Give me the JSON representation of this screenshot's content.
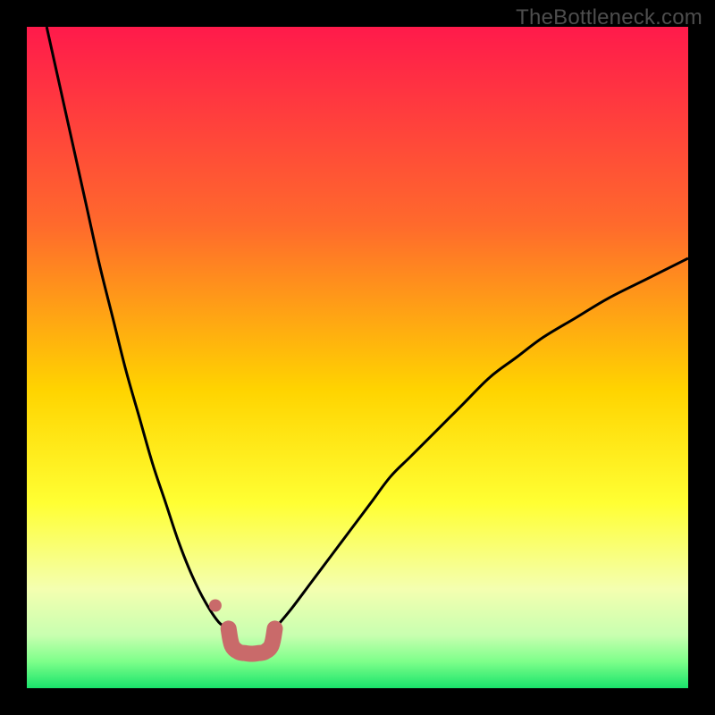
{
  "watermark": "TheBottleneck.com",
  "chart_data": {
    "type": "line",
    "title": "",
    "xlabel": "",
    "ylabel": "",
    "xlim": [
      0,
      100
    ],
    "ylim": [
      0,
      100
    ],
    "series": [
      {
        "name": "left-curve",
        "x": [
          3,
          5,
          7,
          9,
          11,
          13,
          15,
          17,
          19,
          21,
          23,
          25,
          27,
          29,
          30.5
        ],
        "values": [
          100,
          91,
          82,
          73,
          64,
          56,
          48,
          41,
          34,
          28,
          22,
          17,
          13,
          10,
          9
        ]
      },
      {
        "name": "right-curve",
        "x": [
          37.5,
          40,
          43,
          46,
          49,
          52,
          55,
          58,
          62,
          66,
          70,
          74,
          78,
          83,
          88,
          94,
          100
        ],
        "values": [
          9,
          12,
          16,
          20,
          24,
          28,
          32,
          35,
          39,
          43,
          47,
          50,
          53,
          56,
          59,
          62,
          65
        ]
      },
      {
        "name": "highlight-u",
        "x": [
          30.5,
          31,
          32,
          33,
          34,
          35,
          36,
          37,
          37.5
        ],
        "values": [
          9,
          6.5,
          5.5,
          5.3,
          5.2,
          5.3,
          5.5,
          6.5,
          9
        ]
      },
      {
        "name": "highlight-dot",
        "x": [
          28.5
        ],
        "values": [
          12.5
        ]
      }
    ],
    "background_gradient": {
      "stops": [
        {
          "offset": 0.0,
          "color": "#ff1a4b"
        },
        {
          "offset": 0.3,
          "color": "#ff6a2c"
        },
        {
          "offset": 0.55,
          "color": "#ffd400"
        },
        {
          "offset": 0.72,
          "color": "#ffff33"
        },
        {
          "offset": 0.85,
          "color": "#f4ffb0"
        },
        {
          "offset": 0.92,
          "color": "#c8ffb0"
        },
        {
          "offset": 0.96,
          "color": "#7dff8a"
        },
        {
          "offset": 1.0,
          "color": "#19e36b"
        }
      ]
    },
    "colors": {
      "curve": "#000000",
      "highlight": "#c96a6a",
      "frame": "#000000"
    }
  }
}
